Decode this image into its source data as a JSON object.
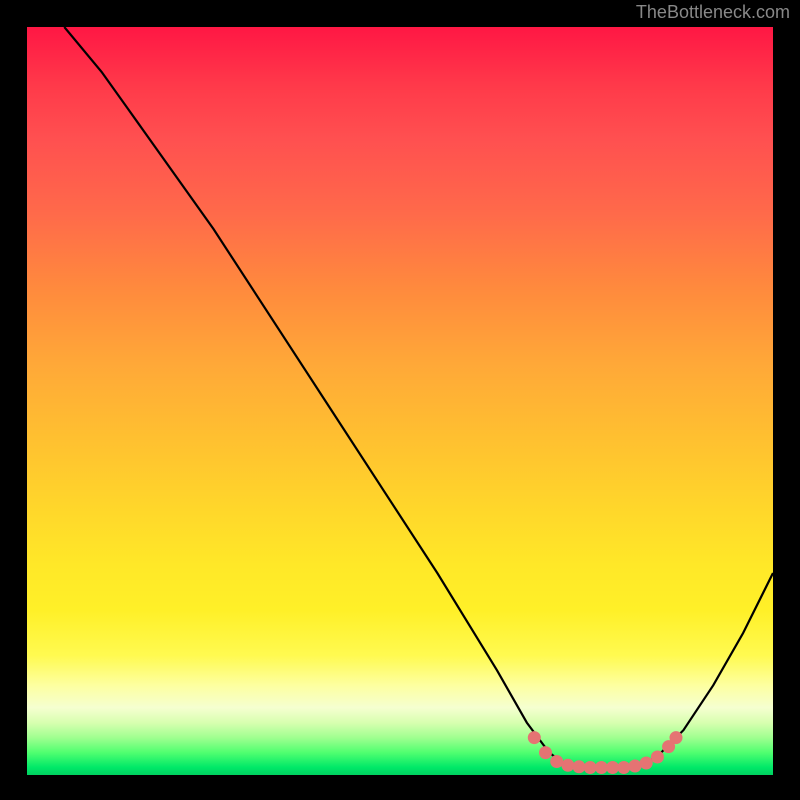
{
  "watermark": "TheBottleneck.com",
  "chart_data": {
    "type": "line",
    "title": "",
    "xlabel": "",
    "ylabel": "",
    "xlim": [
      0,
      100
    ],
    "ylim": [
      0,
      100
    ],
    "series": [
      {
        "name": "curve",
        "color": "#000000",
        "points": [
          {
            "x": 5,
            "y": 100
          },
          {
            "x": 10,
            "y": 94
          },
          {
            "x": 15,
            "y": 87
          },
          {
            "x": 25,
            "y": 73
          },
          {
            "x": 40,
            "y": 50
          },
          {
            "x": 55,
            "y": 27
          },
          {
            "x": 63,
            "y": 14
          },
          {
            "x": 67,
            "y": 7
          },
          {
            "x": 70,
            "y": 3
          },
          {
            "x": 72,
            "y": 1.5
          },
          {
            "x": 75,
            "y": 1
          },
          {
            "x": 80,
            "y": 1
          },
          {
            "x": 83,
            "y": 1.5
          },
          {
            "x": 85,
            "y": 3
          },
          {
            "x": 88,
            "y": 6
          },
          {
            "x": 92,
            "y": 12
          },
          {
            "x": 96,
            "y": 19
          },
          {
            "x": 100,
            "y": 27
          }
        ]
      },
      {
        "name": "highlight-dots",
        "color": "#e57373",
        "points": [
          {
            "x": 68,
            "y": 5
          },
          {
            "x": 69.5,
            "y": 3
          },
          {
            "x": 71,
            "y": 1.8
          },
          {
            "x": 72.5,
            "y": 1.3
          },
          {
            "x": 74,
            "y": 1.1
          },
          {
            "x": 75.5,
            "y": 1
          },
          {
            "x": 77,
            "y": 1
          },
          {
            "x": 78.5,
            "y": 1
          },
          {
            "x": 80,
            "y": 1
          },
          {
            "x": 81.5,
            "y": 1.2
          },
          {
            "x": 83,
            "y": 1.6
          },
          {
            "x": 84.5,
            "y": 2.4
          },
          {
            "x": 86,
            "y": 3.8
          },
          {
            "x": 87,
            "y": 5
          }
        ]
      }
    ],
    "gradient": {
      "stops": [
        {
          "pos": 0,
          "color": "#ff1744"
        },
        {
          "pos": 50,
          "color": "#ffb838"
        },
        {
          "pos": 80,
          "color": "#fff028"
        },
        {
          "pos": 100,
          "color": "#00d860"
        }
      ]
    }
  }
}
